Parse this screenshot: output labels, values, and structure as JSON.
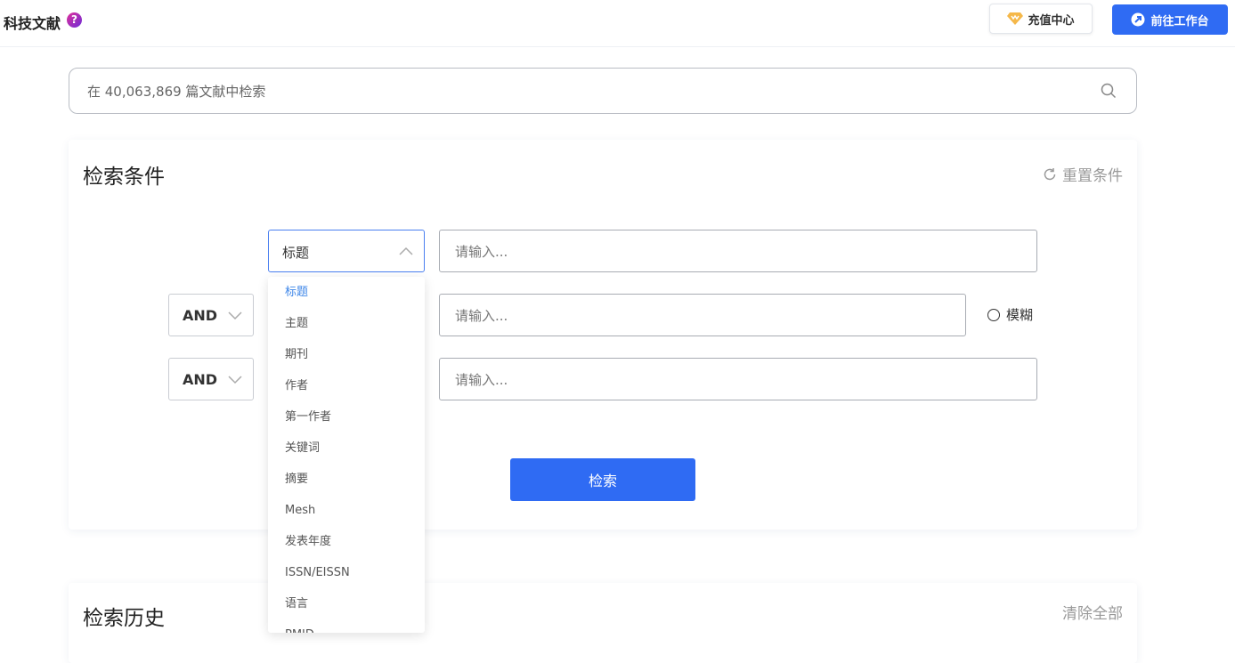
{
  "header": {
    "title": "科技文献",
    "help_icon": "?",
    "recharge_label": "充值中心",
    "workbench_label": "前往工作台"
  },
  "search": {
    "placeholder": "在 40,063,869 篇文献中检索"
  },
  "conditions": {
    "title": "检索条件",
    "reset_label": "重置条件",
    "rows": [
      {
        "field": "标题",
        "placeholder": "请输入..."
      },
      {
        "operator": "AND",
        "placeholder": "请输入..."
      },
      {
        "operator": "AND",
        "placeholder": "请输入..."
      }
    ],
    "fuzzy_label": "模糊",
    "search_button": "检索"
  },
  "dropdown": {
    "selected": "标题",
    "options": [
      "标题",
      "主题",
      "期刊",
      "作者",
      "第一作者",
      "关键词",
      "摘要",
      "Mesh",
      "发表年度",
      "ISSN/EISSN",
      "语言",
      "PMID"
    ]
  },
  "history": {
    "title": "检索历史",
    "clear_label": "清除全部"
  },
  "colors": {
    "primary": "#2f6bf3",
    "selected_option": "#3d86e8",
    "muted_text": "#999999"
  }
}
